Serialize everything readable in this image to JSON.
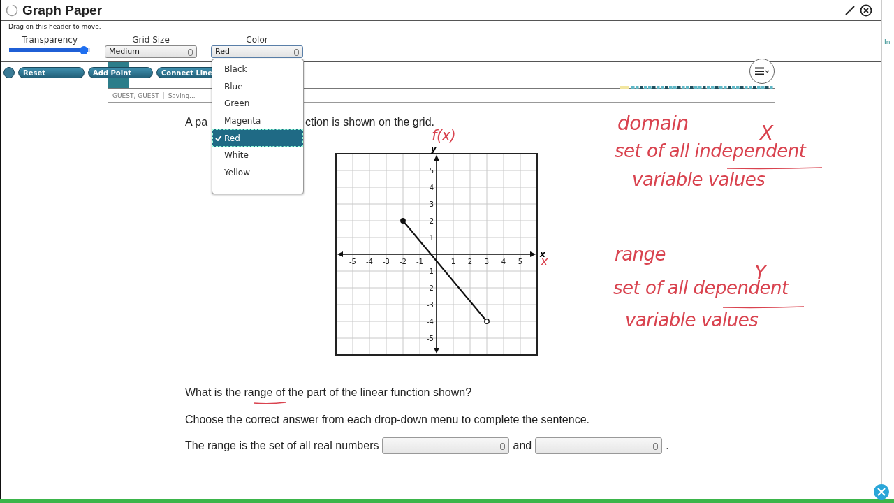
{
  "window": {
    "title": "Graph Paper",
    "hint": "Drag on this header to move."
  },
  "controls": {
    "transparency": {
      "label": "Transparency",
      "level": 0.97
    },
    "grid_size": {
      "label": "Grid Size",
      "value": "Medium"
    },
    "color": {
      "label": "Color",
      "value": "Red",
      "expanded": true,
      "options": [
        {
          "label": "Black",
          "selected": false
        },
        {
          "label": "Blue",
          "selected": false
        },
        {
          "label": "Green",
          "selected": false
        },
        {
          "label": "Magenta",
          "selected": false
        },
        {
          "label": "Red",
          "selected": true
        },
        {
          "label": "White",
          "selected": false
        },
        {
          "label": "Yellow",
          "selected": false
        }
      ]
    }
  },
  "toolbar": {
    "buttons": [
      {
        "label": "Reset",
        "kind": "reset"
      },
      {
        "label": "Add Point",
        "kind": "point"
      },
      {
        "label": "Connect Line",
        "kind": "line"
      }
    ]
  },
  "status": {
    "user": "GUEST, GUEST",
    "state": "Saving..."
  },
  "question": {
    "intro_parts": [
      "A pa",
      "ction is shown on the grid."
    ],
    "chart_data": {
      "type": "line",
      "xlabel": "x",
      "ylabel": "y",
      "x": [
        -2,
        3
      ],
      "series": [
        {
          "color": "#111111",
          "values": [
            2,
            -4
          ],
          "marker": "circle"
        }
      ],
      "grid": true,
      "xlim": [
        -6,
        6
      ],
      "ylim": [
        -6,
        6
      ],
      "xticks": [
        -5,
        -4,
        -3,
        -2,
        -1,
        1,
        2,
        3,
        4,
        5
      ],
      "yticks": [
        -5,
        -4,
        -3,
        -2,
        -1,
        1,
        2,
        3,
        4,
        5
      ]
    },
    "prompt": "What is the range of the part of the linear function shown?",
    "instruction": "Choose the correct answer from each drop-down menu to complete the sentence.",
    "sentence": [
      "The range is the set of all real numbers",
      "and",
      "."
    ]
  },
  "ink": [
    {
      "text": "f(x)",
      "kind": "fx"
    },
    {
      "text": "domain",
      "kind": "domain"
    },
    {
      "text": "X",
      "kind": "bigx"
    },
    {
      "text": "set of all independent",
      "kind": "def1"
    },
    {
      "text": "variable values",
      "kind": "var1"
    },
    {
      "text": "x",
      "kind": "axisx"
    },
    {
      "text": "range",
      "kind": "range"
    },
    {
      "text": "Y",
      "kind": "bigy"
    },
    {
      "text": "set of all dependent",
      "kind": "def2"
    },
    {
      "text": "variable values",
      "kind": "var2"
    }
  ],
  "side_window": {
    "label": "In"
  }
}
